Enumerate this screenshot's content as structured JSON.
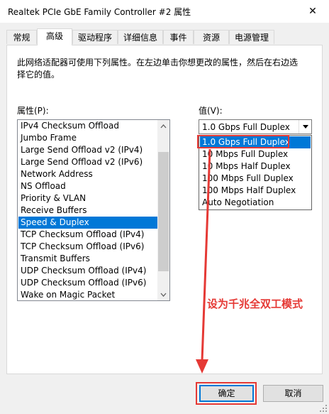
{
  "window": {
    "title": "Realtek PCIe GbE Family Controller #2 属性",
    "close_glyph": "✕"
  },
  "tabs": [
    {
      "label": "常规"
    },
    {
      "label": "高级"
    },
    {
      "label": "驱动程序"
    },
    {
      "label": "详细信息"
    },
    {
      "label": "事件"
    },
    {
      "label": "资源"
    },
    {
      "label": "电源管理"
    }
  ],
  "active_tab": "高级",
  "description": "此网络适配器可使用下列属性。在左边单击你想更改的属性，然后在右边选择它的值。",
  "property_label": "属性(P):",
  "value_label": "值(V):",
  "properties": [
    "IPv4 Checksum Offload",
    "Jumbo Frame",
    "Large Send Offload v2 (IPv4)",
    "Large Send Offload v2 (IPv6)",
    "Network Address",
    "NS Offload",
    "Priority & VLAN",
    "Receive Buffers",
    "Speed & Duplex",
    "TCP Checksum Offload (IPv4)",
    "TCP Checksum Offload (IPv6)",
    "Transmit Buffers",
    "UDP Checksum Offload (IPv4)",
    "UDP Checksum Offload (IPv6)",
    "Wake on Magic Packet"
  ],
  "selected_property": "Speed & Duplex",
  "value_combo": "1.0 Gbps Full Duplex",
  "value_options": [
    "1.0 Gbps Full Duplex",
    "10 Mbps Full Duplex",
    "10 Mbps Half Duplex",
    "100 Mbps Full Duplex",
    "100 Mbps Half Duplex",
    "Auto Negotiation"
  ],
  "selected_option": "1.0 Gbps Full Duplex",
  "annotation": "设为千兆全双工模式",
  "buttons": {
    "ok": "确定",
    "cancel": "取消"
  },
  "colors": {
    "selection": "#0078d7",
    "annotation": "#e53935"
  }
}
